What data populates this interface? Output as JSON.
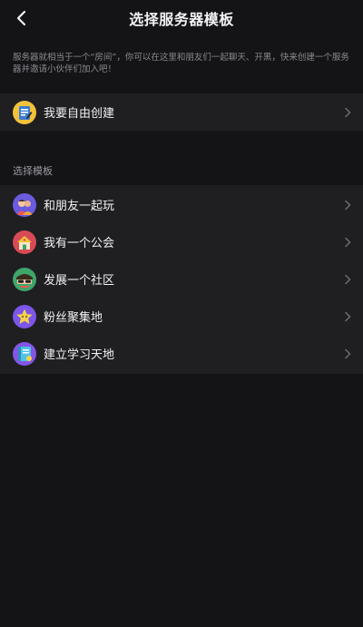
{
  "header": {
    "title": "选择服务器模板"
  },
  "description": "服务器就相当于一个“房间”，你可以在这里和朋友们一起聊天、开黑，快来创建一个服务器并邀请小伙伴们加入吧！",
  "custom_create": {
    "label": "我要自由创建",
    "icon": "notepad-icon"
  },
  "section": {
    "label": "选择模板"
  },
  "templates": [
    {
      "label": "和朋友一起玩",
      "icon": "friends-icon",
      "color": "#6a5be0"
    },
    {
      "label": "我有一个公会",
      "icon": "guild-house-icon",
      "color": "#d84a55"
    },
    {
      "label": "发展一个社区",
      "icon": "community-icon",
      "color": "#3ea56b"
    },
    {
      "label": "粉丝聚集地",
      "icon": "star-icon",
      "color": "#7b56e8"
    },
    {
      "label": "建立学习天地",
      "icon": "book-icon",
      "color": "#8455e6"
    }
  ],
  "colors": {
    "background": "#141416",
    "row": "#1f1f22",
    "chevron": "#6c6c72"
  }
}
